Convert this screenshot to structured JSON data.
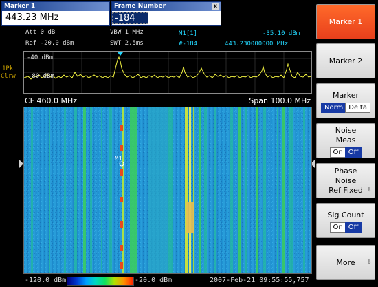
{
  "marker_dialog": {
    "title": "Marker 1",
    "value": "443.23 MHz"
  },
  "frame_dialog": {
    "title": "Frame Number",
    "value": "-184",
    "close": "x"
  },
  "info": {
    "att": "Att  0 dB",
    "vbw": "VBW 1 MHz",
    "ref": "Ref -20.0 dBm",
    "swt": "SWT 2.5ms",
    "marker_label": "M1[1]",
    "marker_level": "-35.10 dBm",
    "marker_frame": "#-184",
    "marker_freq": "443.230000000 MHz",
    "trace_mode_1": "1Pk",
    "trace_mode_2": "Clrw"
  },
  "spectrum": {
    "ref_line_label": "-40 dBm",
    "ref2_label": "-80 dBm"
  },
  "waterfall": {
    "cf": "CF 460.0 MHz",
    "span": "Span 100.0 MHz",
    "marker_tag": "M1"
  },
  "colorbar": {
    "min": "-120.0 dBm",
    "max": "-20.0 dBm",
    "timestamp": "2007-Feb-21 09:55:55,757"
  },
  "softkeys": {
    "marker1": "Marker 1",
    "marker2": "Marker 2",
    "marker": "Marker",
    "norm": "Norm",
    "delta": "Delta",
    "noise_l1": "Noise",
    "noise_l2": "Meas",
    "on": "On",
    "off": "Off",
    "phase_l1": "Phase",
    "phase_l2": "Noise",
    "phase_l3": "Ref Fixed",
    "sig_count": "Sig Count",
    "on2": "On",
    "off2": "Off",
    "more": "More"
  },
  "colors": {
    "accent": "#e8401c",
    "trace": "#f0f040",
    "marker": "#22d8ff"
  }
}
